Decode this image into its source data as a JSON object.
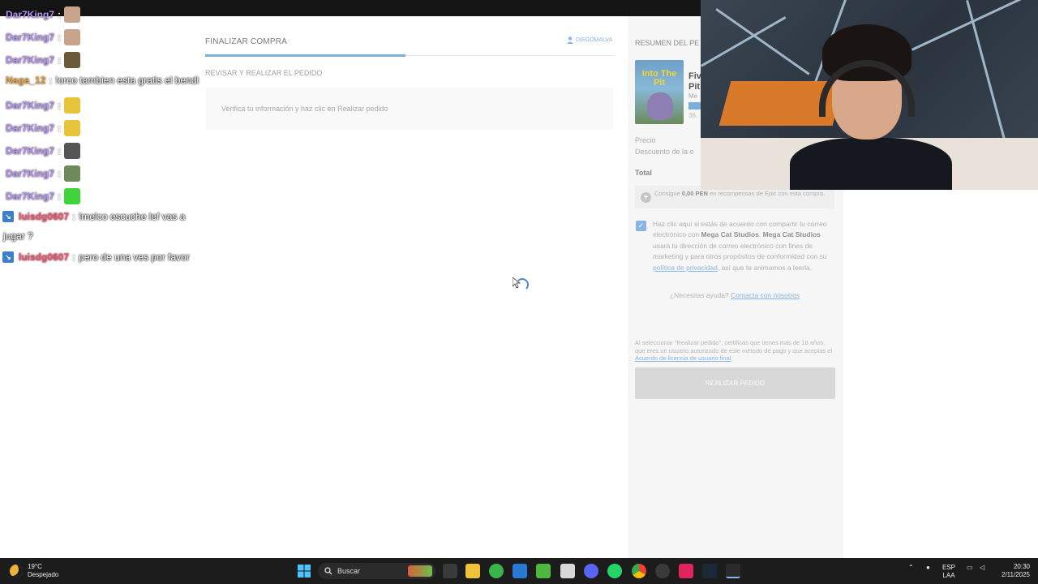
{
  "checkout": {
    "header_title": "FINALIZAR COMPRA",
    "user_name": "DIEGOMALVA",
    "progress": 0.49,
    "section_label": "REVISAR Y REALIZAR EL PEDIDO",
    "info_text": "Verifica tu información y haz clic en Realizar pedido"
  },
  "summary": {
    "title": "RESUMEN DEL PE",
    "thumb_text": "Into The Pit",
    "game_title_line1": "Fiv",
    "game_title_line2": "Pit",
    "game_publisher": "Me",
    "game_old_price": "36,",
    "price_label": "Precio",
    "discount_label": "Descuento de la o",
    "total_label": "Total",
    "rewards_pre": "Consigue",
    "rewards_amount": "0,00 PEN",
    "rewards_post": "en recompensas de Epic con esta compra.",
    "consent_pre": "Haz clic aquí si estás de acuerdo con compartir tu correo electrónico con",
    "consent_pub1": "Mega Cat Studios",
    "consent_pub2": "Mega Cat Studios",
    "consent_mid": "usará tu dirección de correo electrónico con fines de marketing y para otros propósitos de conformidad con su",
    "consent_link": "política de privacidad",
    "consent_post": ", así que te animamos a leerla.",
    "help_question": "¿Necesitas ayuda?",
    "help_link": "Contacta con nosotros",
    "legal_text": "Al seleccionar \"Realizar pedido\", certificas que tienes más de 18 años, que eres un usuario autorizado de este método de pago y que aceptas el",
    "legal_link": "Acuerdo de licencia de usuario final",
    "legal_end": ".",
    "place_order_label": "REALIZAR PEDIDO"
  },
  "chat": {
    "messages": [
      {
        "nick": "Dar7King7",
        "color": "#b691f2",
        "msg": "",
        "emote": "#c9a38a"
      },
      {
        "nick": "Dar7King7",
        "color": "#b691f2",
        "msg": "",
        "emote": "#c9a38a"
      },
      {
        "nick": "Dar7King7",
        "color": "#b691f2",
        "msg": "",
        "emote": "#6b5a3a"
      },
      {
        "nick": "Naga_12",
        "color": "#e8a43a",
        "msg": "!orco tambien esta gratis el bendi",
        "emote": ""
      },
      {
        "nick": "Dar7King7",
        "color": "#b691f2",
        "msg": "",
        "emote": "#e8c43a"
      },
      {
        "nick": "Dar7King7",
        "color": "#b691f2",
        "msg": "",
        "emote": "#e8c43a"
      },
      {
        "nick": "Dar7King7",
        "color": "#b691f2",
        "msg": "",
        "emote": "#555555"
      },
      {
        "nick": "Dar7King7",
        "color": "#b691f2",
        "msg": "",
        "emote": "#6d8a5a"
      },
      {
        "nick": "Dar7King7",
        "color": "#b691f2",
        "msg": "",
        "emote": "#3ed43a"
      },
      {
        "nick": "luisdg0607",
        "color": "#ff4f6d",
        "msg": "!melco escuche lef vas a",
        "emote": "",
        "bot": true
      },
      {
        "nick": "luisdg0607",
        "color": "#ff4f6d",
        "msg": "pero de una ves por favor",
        "emote": "",
        "bot": true
      }
    ],
    "wrap_line": "jugar ?"
  },
  "taskbar": {
    "weather_temp": "19°C",
    "weather_desc": "Despejado",
    "search_label": "Buscar",
    "lang_top": "ESP",
    "lang_bottom": "LAA",
    "time": "20:30",
    "date": "2/11/2025"
  }
}
